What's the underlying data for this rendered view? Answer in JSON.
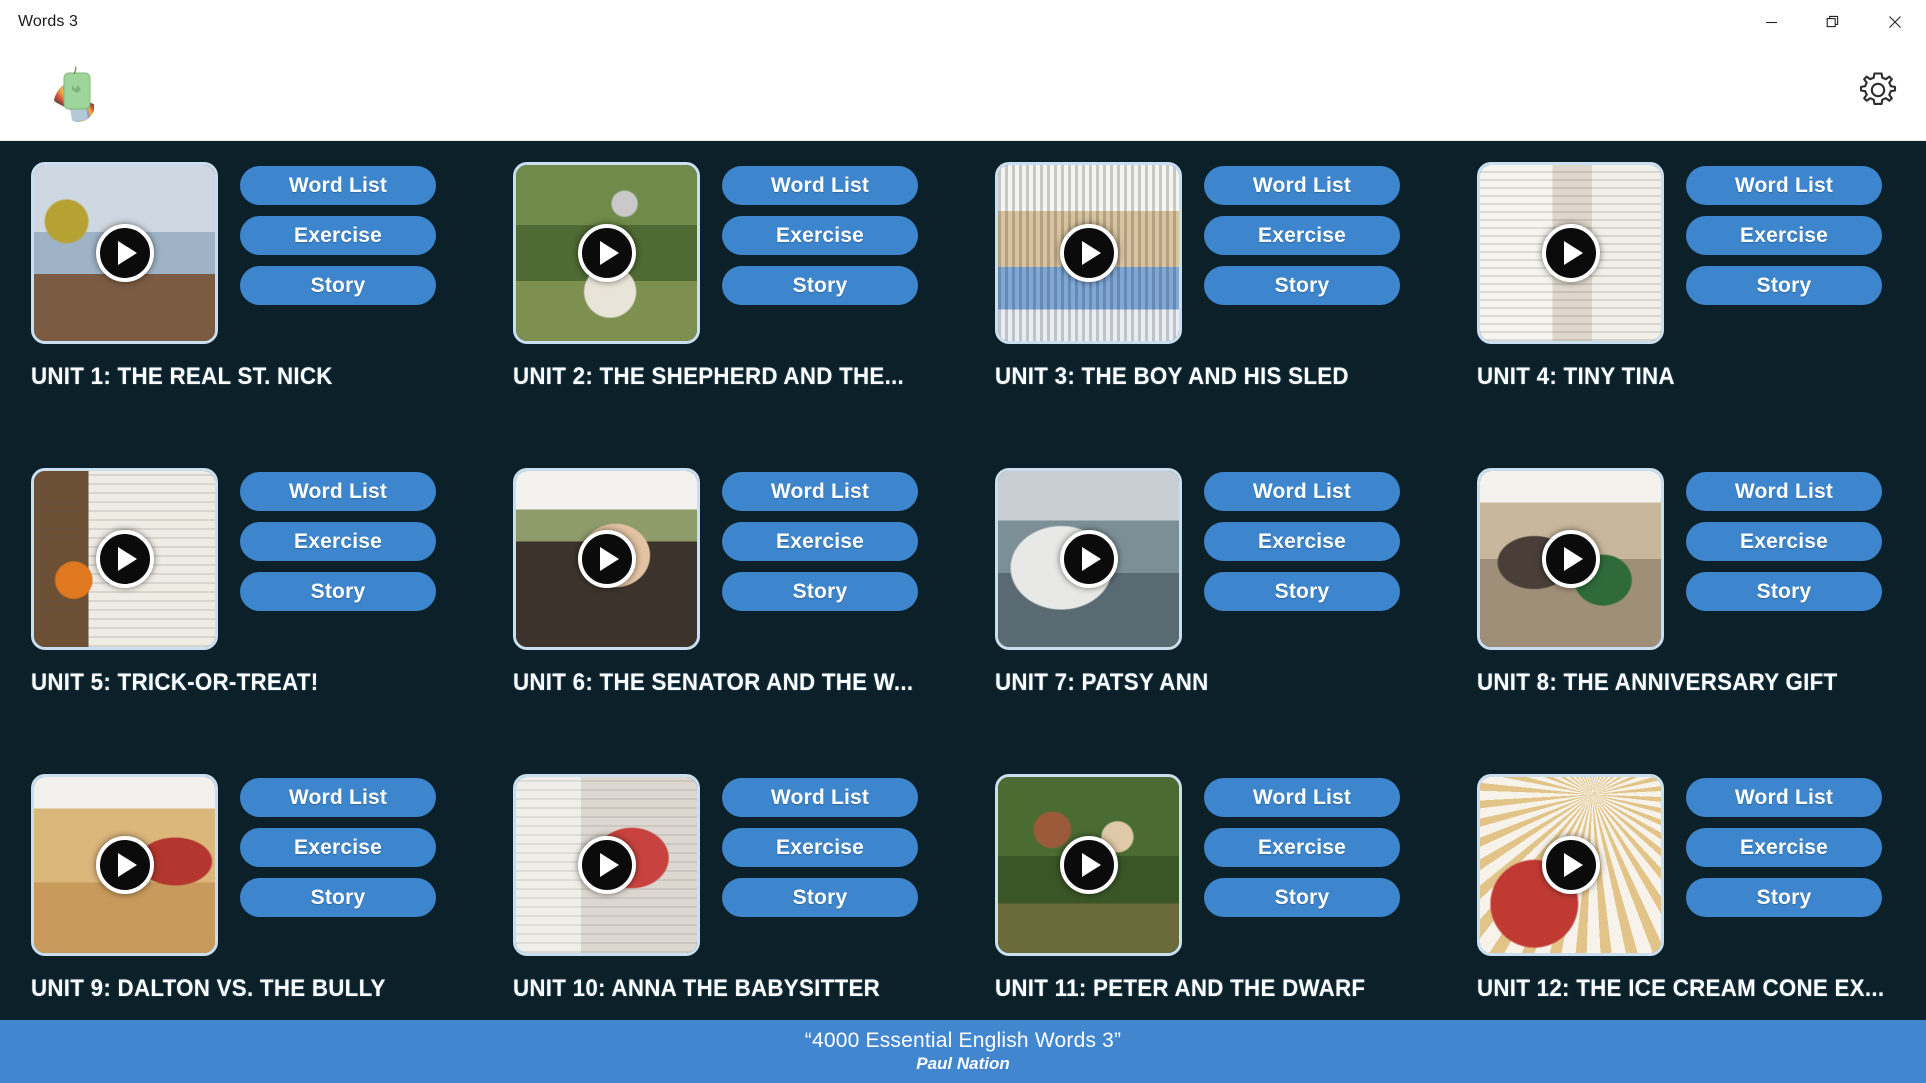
{
  "window": {
    "title": "Words 3",
    "controls": [
      {
        "name": "minimize",
        "glyph": "minimize-icon"
      },
      {
        "name": "restore",
        "glyph": "restore-icon"
      },
      {
        "name": "close",
        "glyph": "close-icon"
      }
    ]
  },
  "header": {
    "logo_icon": "color-swatch-fan-icon",
    "settings_icon": "gear-icon"
  },
  "buttons": {
    "word_list": "Word List",
    "exercise": "Exercise",
    "story": "Story",
    "play_icon": "play-icon"
  },
  "colors": {
    "background": "#0b2028",
    "button": "#3d85cc",
    "footer": "#4186cf",
    "titlebar": "#ffffff",
    "thumb_border": "#c9dff0",
    "text": "#ffffff"
  },
  "units": [
    {
      "number": 1,
      "title": "UNIT 1: THE REAL ST. NICK",
      "thumb": "santa-by-fireplace"
    },
    {
      "number": 2,
      "title": "UNIT 2: THE SHEPHERD AND THE...",
      "thumb": "shepherd-with-sheep"
    },
    {
      "number": 3,
      "title": "UNIT 3: THE BOY AND HIS SLED",
      "thumb": "boys-with-sled"
    },
    {
      "number": 4,
      "title": "UNIT 4: TINY TINA",
      "thumb": "girl-in-white-dress"
    },
    {
      "number": 5,
      "title": "UNIT 5: TRICK-OR-TREAT!",
      "thumb": "child-in-costume"
    },
    {
      "number": 6,
      "title": "UNIT 6: THE SENATOR AND THE W...",
      "thumb": "man-in-suit-speaking"
    },
    {
      "number": 7,
      "title": "UNIT 7: PATSY ANN",
      "thumb": "dog-at-harbor"
    },
    {
      "number": 8,
      "title": "UNIT 8: THE ANNIVERSARY GIFT",
      "thumb": "couple-facing-each-other"
    },
    {
      "number": 9,
      "title": "UNIT 9: DALTON VS. THE BULLY",
      "thumb": "two-boys-in-gym"
    },
    {
      "number": 10,
      "title": "UNIT 10: ANNA THE BABYSITTER",
      "thumb": "woman-arms-crossed"
    },
    {
      "number": 11,
      "title": "UNIT 11: PETER AND THE DWARF",
      "thumb": "children-in-forest"
    },
    {
      "number": 12,
      "title": "UNIT 12: THE ICE CREAM CONE EX...",
      "thumb": "boy-with-cones"
    }
  ],
  "footer": {
    "title": "“4000 Essential English Words 3”",
    "author": "Paul Nation"
  }
}
